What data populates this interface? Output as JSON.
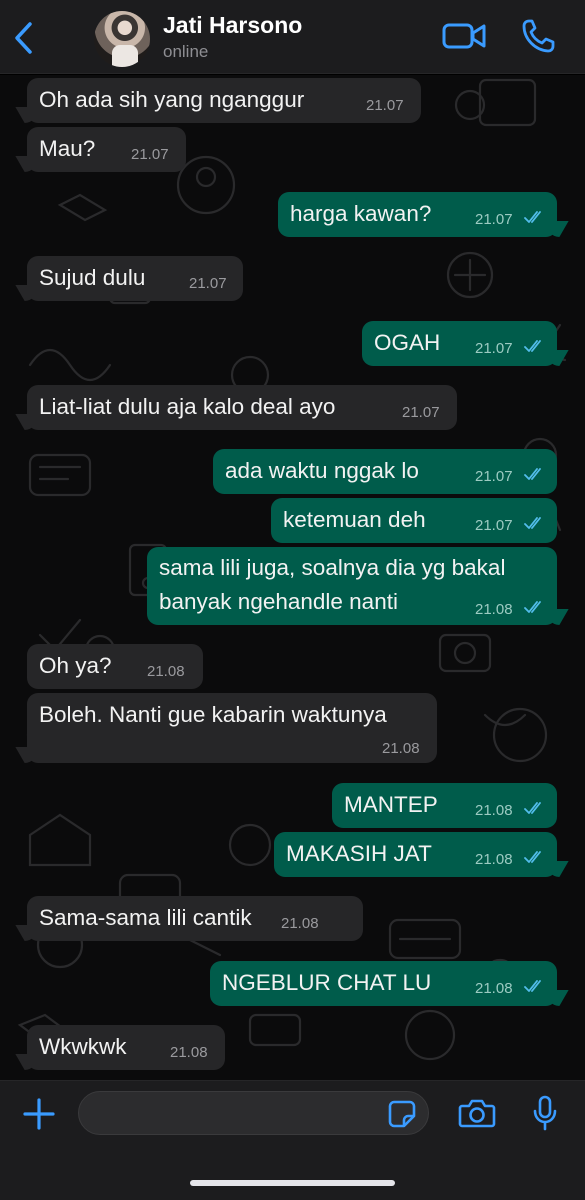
{
  "header": {
    "contact_name": "Jati Harsono",
    "status": "online"
  },
  "colors": {
    "accent": "#3a9bff",
    "incoming_bubble": "#262628",
    "outgoing_bubble": "#005c4b",
    "read_ticks": "#53bdeb"
  },
  "icons": {
    "back": "chevron-left-icon",
    "video": "video-camera-icon",
    "call": "phone-icon",
    "attach": "plus-icon",
    "sticker": "sticker-icon",
    "camera": "camera-icon",
    "mic": "microphone-icon"
  },
  "messages": [
    {
      "direction": "in",
      "text": "Oh ada sih yang nganggur",
      "time": "21.07"
    },
    {
      "direction": "in",
      "text": "Mau?",
      "time": "21.07"
    },
    {
      "direction": "out",
      "text": "harga kawan?",
      "time": "21.07",
      "read": true
    },
    {
      "direction": "in",
      "text": "Sujud dulu",
      "time": "21.07"
    },
    {
      "direction": "out",
      "text": "OGAH",
      "time": "21.07",
      "read": true
    },
    {
      "direction": "in",
      "text": "Liat-liat dulu aja kalo deal ayo",
      "time": "21.07"
    },
    {
      "direction": "out",
      "text": "ada waktu nggak lo",
      "time": "21.07",
      "read": true
    },
    {
      "direction": "out",
      "text": "ketemuan deh",
      "time": "21.07",
      "read": true
    },
    {
      "direction": "out",
      "text_line1": "sama lili juga, soalnya dia yg bakal",
      "text_line2": "banyak ngehandle nanti",
      "time": "21.08",
      "read": true
    },
    {
      "direction": "in",
      "text": "Oh ya?",
      "time": "21.08"
    },
    {
      "direction": "in",
      "text": "Boleh. Nanti gue kabarin waktunya",
      "time": "21.08"
    },
    {
      "direction": "out",
      "text": "MANTEP",
      "time": "21.08",
      "read": true
    },
    {
      "direction": "out",
      "text": "MAKASIH JAT",
      "time": "21.08",
      "read": true
    },
    {
      "direction": "in",
      "text": "Sama-sama lili cantik",
      "time": "21.08"
    },
    {
      "direction": "out",
      "text": "NGEBLUR CHAT LU",
      "time": "21.08",
      "read": true
    },
    {
      "direction": "in",
      "text": "Wkwkwk",
      "time": "21.08"
    }
  ],
  "composer": {
    "placeholder": ""
  }
}
